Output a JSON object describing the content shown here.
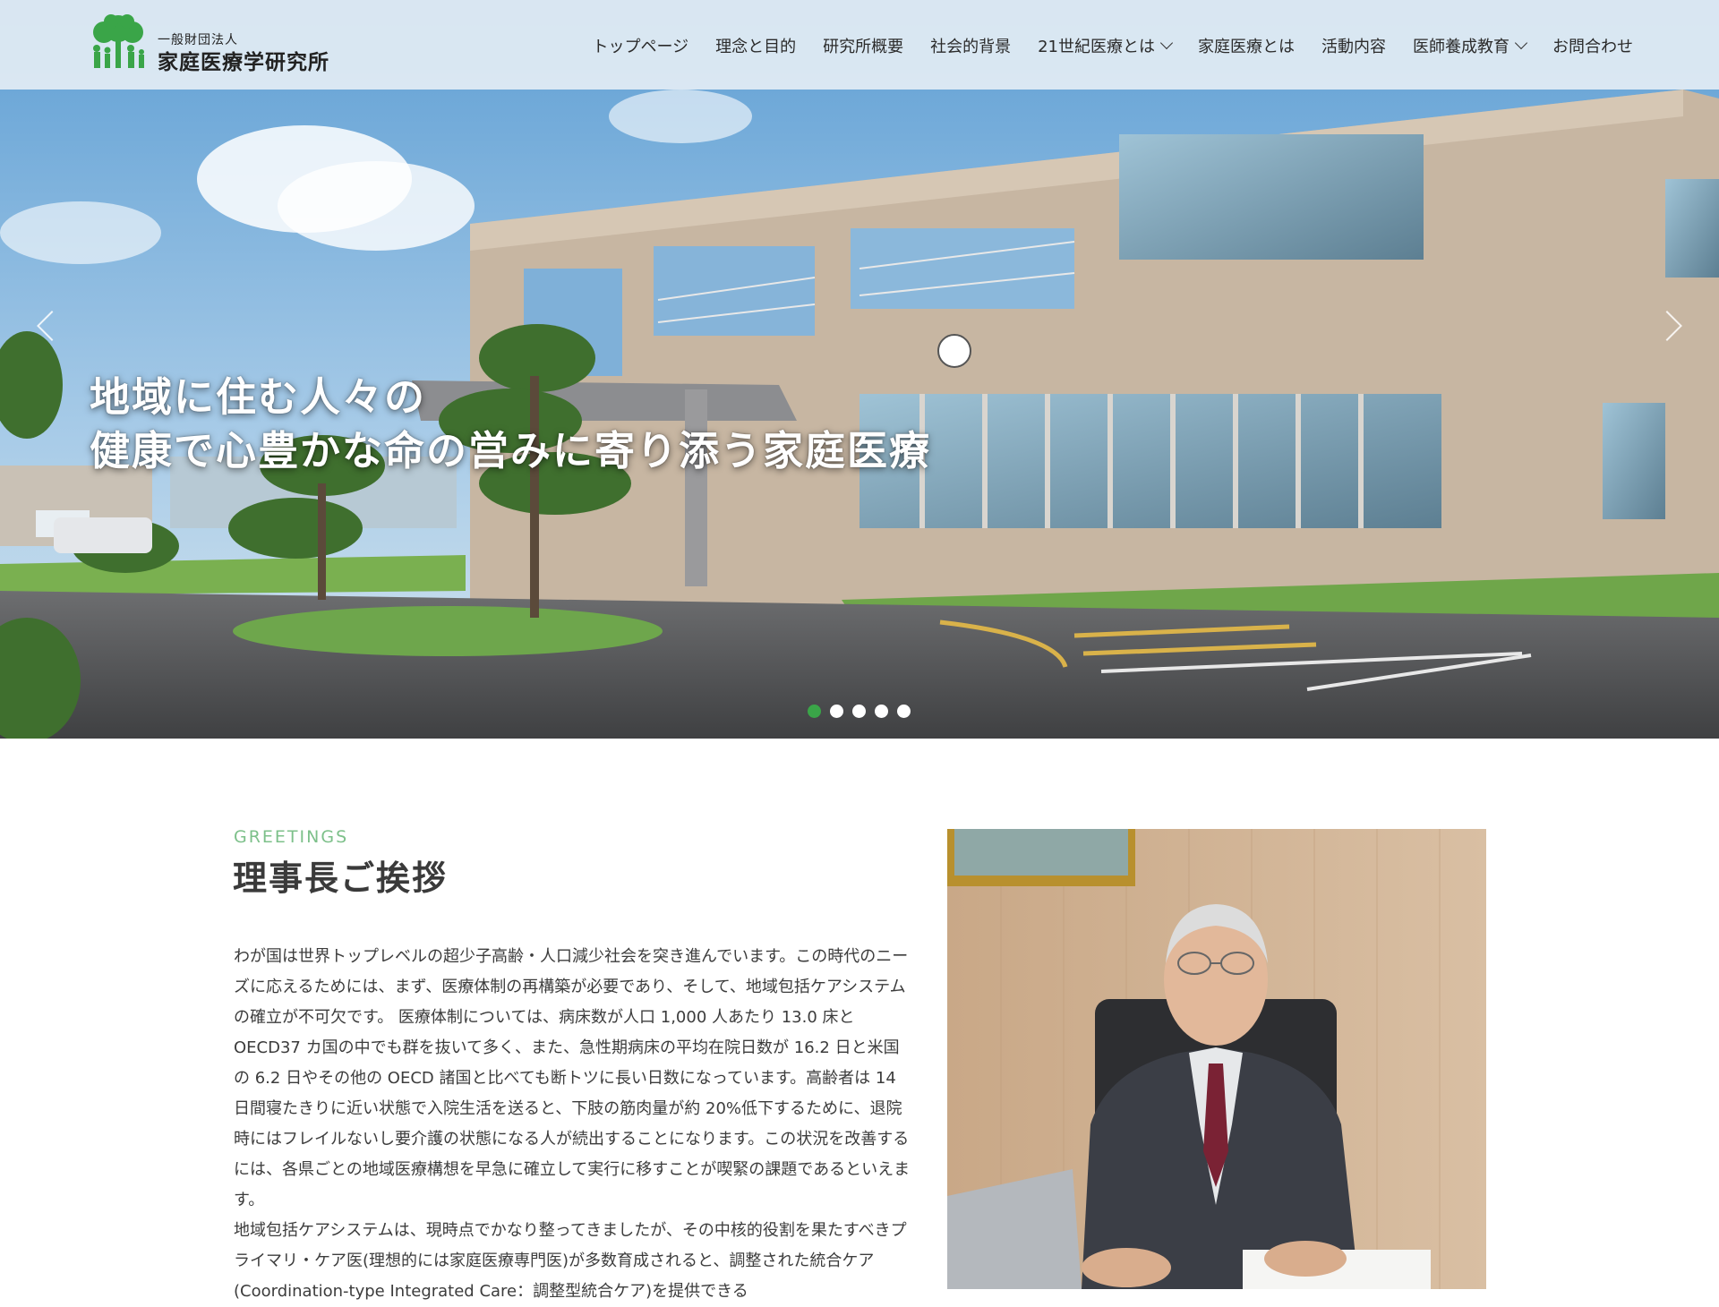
{
  "header": {
    "logo": {
      "org_type": "一般財団法人",
      "org_name": "家庭医療学研究所",
      "brand_color": "#3aa548"
    },
    "nav": [
      {
        "label": "トップページ",
        "dropdown": false
      },
      {
        "label": "理念と目的",
        "dropdown": false
      },
      {
        "label": "研究所概要",
        "dropdown": false
      },
      {
        "label": "社会的背景",
        "dropdown": false
      },
      {
        "label": "21世紀医療とは",
        "dropdown": true
      },
      {
        "label": "家庭医療とは",
        "dropdown": false
      },
      {
        "label": "活動内容",
        "dropdown": false
      },
      {
        "label": "医師養成教育",
        "dropdown": true
      },
      {
        "label": "お問合わせ",
        "dropdown": false
      }
    ]
  },
  "hero": {
    "heading_line1": "地域に住む人々の",
    "heading_line2": "健康で心豊かな命の営みに寄り添う家庭医療",
    "slide_count": 5,
    "active_slide": 1,
    "active_dot_color": "#3aa548"
  },
  "greetings": {
    "eyebrow": "GREETINGS",
    "title": "理事長ご挨拶",
    "paragraph1": "わが国は世界トップレベルの超少子高齢・人口減少社会を突き進んでいます。この時代のニーズに応えるためには、まず、医療体制の再構築が必要であり、そして、地域包括ケアシステムの確立が不可欠です。 医療体制については、病床数が人口 1,000 人あたり 13.0 床と OECD37 カ国の中でも群を抜いて多く、また、急性期病床の平均在院日数が 16.2 日と米国の 6.2 日やその他の OECD 諸国と比べても断トツに長い日数になっています。高齢者は 14 日間寝たきりに近い状態で入院生活を送ると、下肢の筋肉量が約 20%低下するために、退院時にはフレイルないし要介護の状態になる人が続出することになります。この状況を改善するには、各県ごとの地域医療構想を早急に確立して実行に移すことが喫緊の課題であるといえます。",
    "paragraph2": "地域包括ケアシステムは、現時点でかなり整ってきましたが、その中核的役割を果たすべきプライマリ・ケア医(理想的には家庭医療専門医)が多数育成されると、調整された統合ケア(Coordination-type Integrated Care：調整型統合ケア)を提供できる"
  }
}
